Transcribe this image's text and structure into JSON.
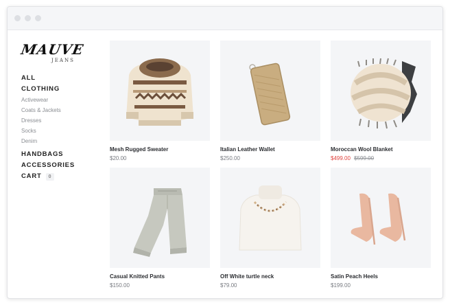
{
  "brand": {
    "name": "MAUVE",
    "sub": "JEANS"
  },
  "nav": {
    "all": "ALL",
    "clothing": "CLOTHING",
    "clothing_items": [
      "Activewear",
      "Coats & Jackets",
      "Dresses",
      "Socks",
      "Denim"
    ],
    "handbags": "HANDBAGS",
    "accessories": "ACCESSORIES",
    "cart": "CART",
    "cart_count": "0"
  },
  "products": [
    {
      "name": "Mesh Rugged Sweater",
      "price": "$20.00",
      "icon": "sweater-image"
    },
    {
      "name": "Italian Leather Wallet",
      "price": "$250.00",
      "icon": "wallet-image"
    },
    {
      "name": "Moroccan Wool Blanket",
      "sale_price": "$499.00",
      "original_price": "$599.00",
      "icon": "blanket-image"
    },
    {
      "name": "Casual Knitted Pants",
      "price": "$150.00",
      "icon": "pants-image"
    },
    {
      "name": "Off White turtle neck",
      "price": "$79.00",
      "icon": "turtleneck-image"
    },
    {
      "name": "Satin Peach Heels",
      "price": "$199.00",
      "icon": "heels-image"
    }
  ],
  "colors": {
    "sale": "#e0433e",
    "thumb_bg": "#f4f5f7",
    "text": "#2b2d31"
  }
}
